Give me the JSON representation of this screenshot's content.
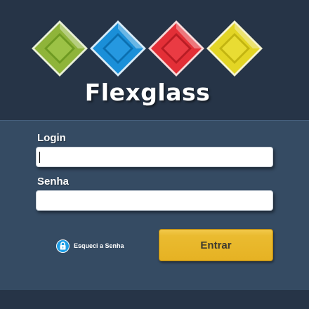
{
  "brand": {
    "name": "Flexglass"
  },
  "logo": {
    "diamonds": [
      {
        "name": "green",
        "color": "#8fb43a"
      },
      {
        "name": "blue",
        "color": "#1a8fd8"
      },
      {
        "name": "red",
        "color": "#e32f37"
      },
      {
        "name": "yellow",
        "color": "#e3d525"
      }
    ]
  },
  "form": {
    "login_label": "Login",
    "login_value": "",
    "password_label": "Senha",
    "password_value": "",
    "forgot_label": "Esqueci a Senha",
    "submit_label": "Entrar"
  },
  "colors": {
    "background": "#263447",
    "panel": "#354b63",
    "accent_button": "#e6b223",
    "forgot_badge": "#1e9ee6"
  }
}
